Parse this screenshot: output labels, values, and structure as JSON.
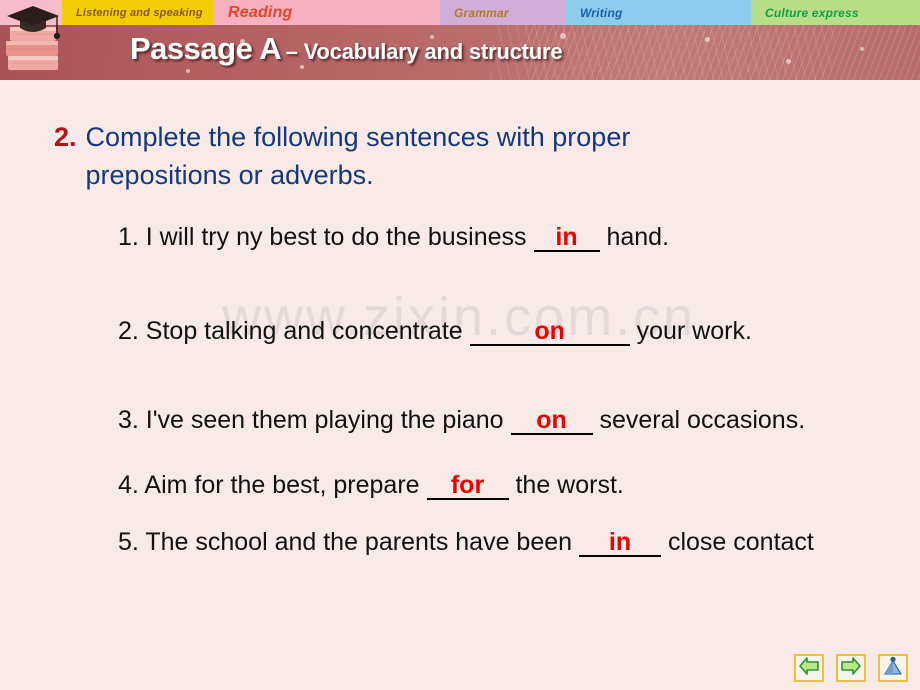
{
  "tabs": [
    {
      "id": "listening",
      "label": "Listening and speaking",
      "bg": "#f2cd06",
      "color": "#8a5b1e"
    },
    {
      "id": "reading",
      "label": "Reading",
      "bg": "#f5b0c2",
      "color": "#e8442a"
    },
    {
      "id": "grammar",
      "label": "Grammar",
      "bg": "#d0aed7",
      "color": "#b07a20"
    },
    {
      "id": "writing",
      "label": "Writing",
      "bg": "#8fcbec",
      "color": "#1b5fa8"
    },
    {
      "id": "culture",
      "label": "Culture express",
      "bg": "#b9dd84",
      "color": "#0fa04c"
    }
  ],
  "banner": {
    "title_main": "Passage A",
    "title_sub": "– Vocabulary and structure",
    "bg_color": "#b25f62",
    "text_color": "#ffffff"
  },
  "logo": {
    "name": "graduation-cap-on-books"
  },
  "question": {
    "number": "2.",
    "number_color": "#b31217",
    "text": "Complete the following sentences with proper prepositions or adverbs.",
    "text_color": "#16387c"
  },
  "answer_color": "#ee0000",
  "sentences": [
    {
      "index": "1.",
      "before": "1. I will try ny best to do the business",
      "answer": "in",
      "after": "hand.",
      "blank_size": "sm"
    },
    {
      "index": "2.",
      "before": "2. Stop talking and concentrate",
      "answer": "on",
      "after": "your work.",
      "blank_size": "lg"
    },
    {
      "index": "3.",
      "before": "3. I've seen them playing the piano",
      "answer": "on",
      "after": "several occasions.",
      "blank_size": "md"
    },
    {
      "index": "4.",
      "before": "4. Aim for the best, prepare",
      "answer": "for",
      "after": "the worst.",
      "blank_size": "md"
    },
    {
      "index": "5.",
      "before": "5. The school and the parents have been",
      "answer": "in",
      "after": "close contact",
      "blank_size": "md"
    }
  ],
  "watermark": {
    "text": "www.zixin.com.cn"
  },
  "nav_buttons": [
    {
      "id": "previous",
      "icon": "arrow-left-icon",
      "label": "Previous slide"
    },
    {
      "id": "next",
      "icon": "arrow-right-icon",
      "label": "Next slide"
    },
    {
      "id": "home",
      "icon": "home-cone-icon",
      "label": "Home"
    }
  ]
}
